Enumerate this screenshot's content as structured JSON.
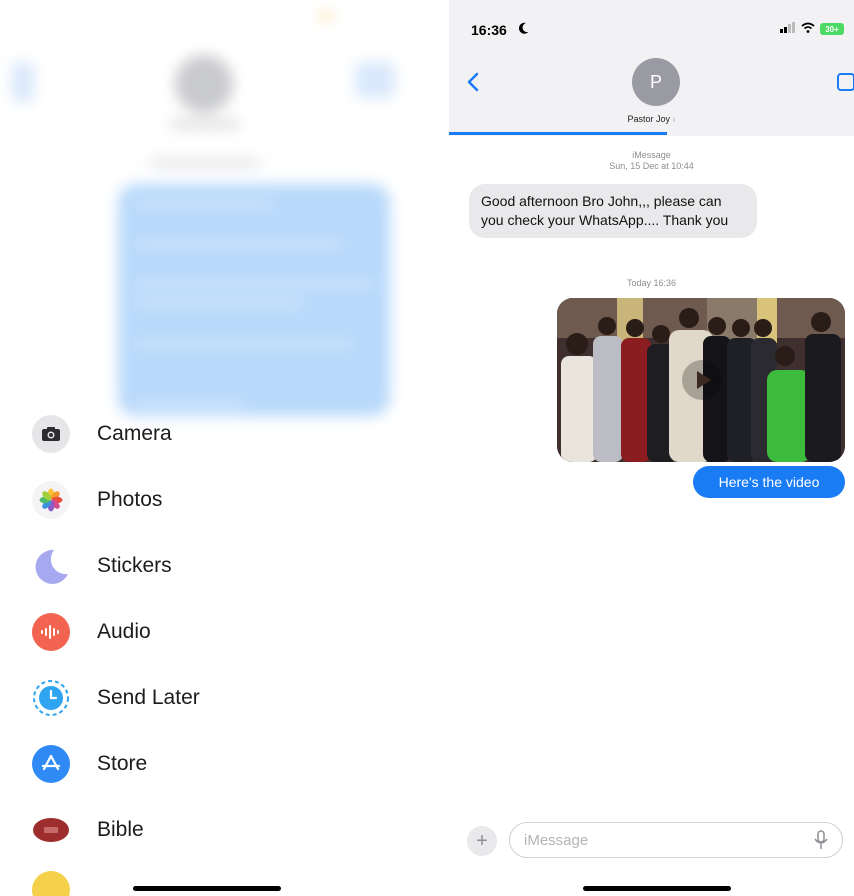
{
  "menu": {
    "items": [
      {
        "label": "Camera",
        "icon": "camera-icon",
        "color": "#2c2c2e"
      },
      {
        "label": "Photos",
        "icon": "photos-icon",
        "color": "#ffffff"
      },
      {
        "label": "Stickers",
        "icon": "stickers-icon",
        "color": "#9fa6ef"
      },
      {
        "label": "Audio",
        "icon": "audio-icon",
        "color": "#f2644f"
      },
      {
        "label": "Send Later",
        "icon": "send-later-icon",
        "color": "#2fa4f0"
      },
      {
        "label": "Store",
        "icon": "store-icon",
        "color": "#2f8af5"
      },
      {
        "label": "Bible",
        "icon": "bible-icon",
        "color": "#9e2d2d"
      }
    ]
  },
  "status": {
    "time": "16:36",
    "battery": "30+"
  },
  "contact": {
    "initial": "P",
    "name": "Pastor Joy"
  },
  "messages": {
    "header_service": "iMessage",
    "header_date": "Sun, 15 Dec at 10:44",
    "incoming_text": "Good afternoon Bro John,,, please can you check your WhatsApp.... Thank you",
    "today_ts": "Today 16:36",
    "outgoing_text": "Here's the video"
  },
  "composer": {
    "placeholder": "iMessage"
  },
  "colors": {
    "accent": "#1a7cf5",
    "incoming_bubble": "#e9e9eb",
    "topbar": "#f2f2f4"
  }
}
